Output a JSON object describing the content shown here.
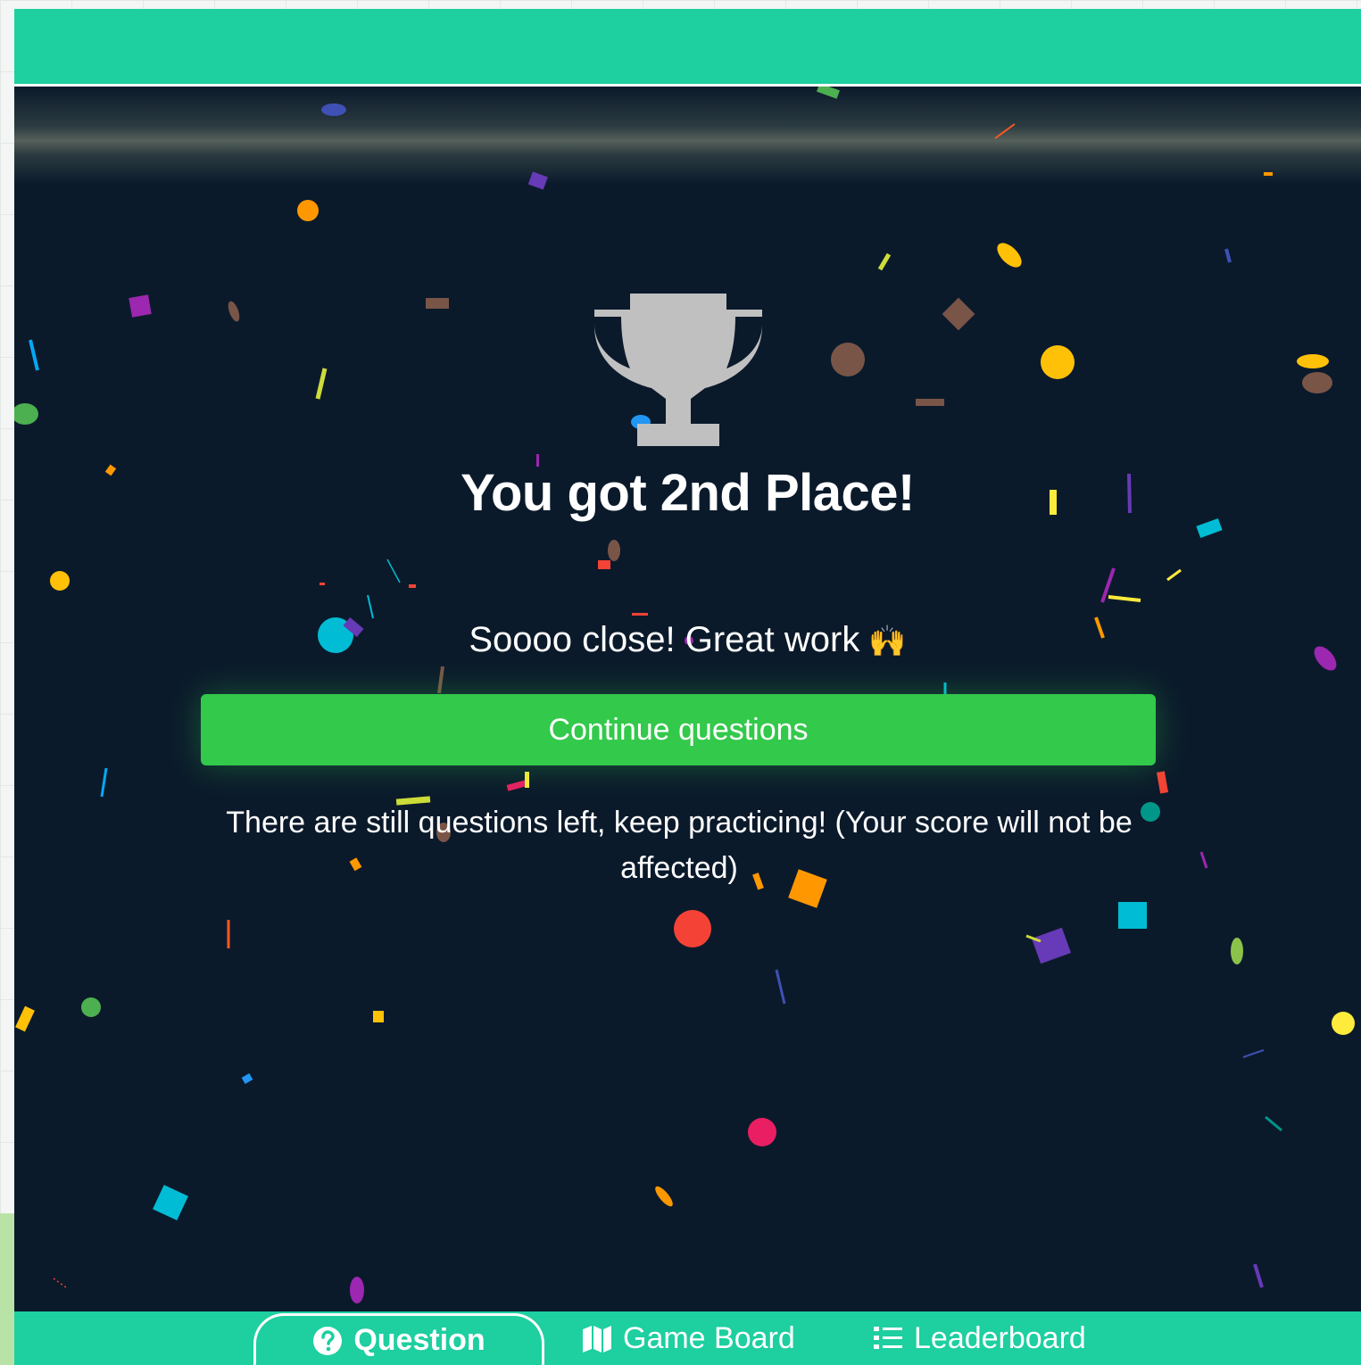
{
  "result": {
    "title": "You got 2nd Place!",
    "subtitle": "Soooo close! Great work",
    "subtitle_emoji": "🙌",
    "continue_label": "Continue questions",
    "note": "There are still questions left, keep practicing! (Your score will not be affected)"
  },
  "tabs": [
    {
      "label": "Question",
      "icon": "question-circle-icon",
      "active": true
    },
    {
      "label": "Game Board",
      "icon": "map-icon",
      "active": false
    },
    {
      "label": "Leaderboard",
      "icon": "list-icon",
      "active": false
    }
  ],
  "colors": {
    "header": "#1ecfa0",
    "stage": "#0b1a2b",
    "button": "#33c94b",
    "trophy": "#c0c0c0"
  },
  "icons": {
    "trophy": "trophy-icon",
    "emoji": "raising-hands-emoji"
  }
}
